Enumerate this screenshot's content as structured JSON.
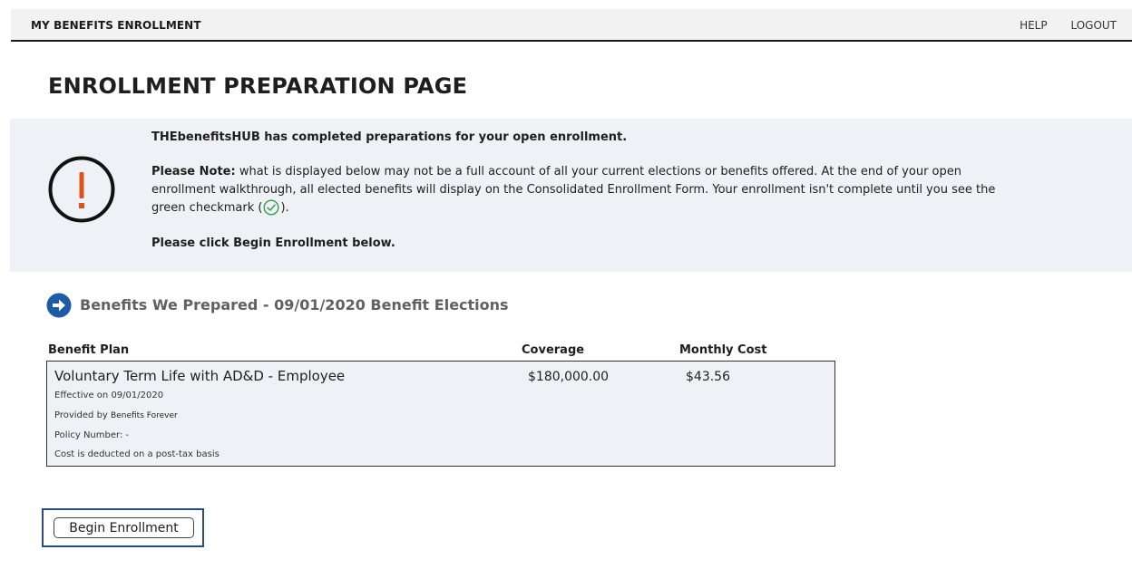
{
  "header": {
    "app_title": "MY BENEFITS ENROLLMENT",
    "nav": {
      "help": "HELP",
      "logout": "LOGOUT"
    }
  },
  "page_title": "ENROLLMENT PREPARATION PAGE",
  "notice": {
    "icon": "warning-exclamation-icon",
    "headline": "THEbenefitsHUB has completed preparations for your open enrollment.",
    "note_label": "Please Note:",
    "note_text": "what is displayed below may not be a full account of all your current elections or benefits offered. At the end of your open enrollment walkthrough, all elected benefits will display on the Consolidated Enrollment Form. Your enrollment isn't complete until you see the green checkmark (",
    "note_suffix": ").",
    "instruction": "Please click Begin Enrollment below."
  },
  "section": {
    "icon": "arrow-right-circle-icon",
    "title": "Benefits We Prepared - 09/01/2020 Benefit Elections"
  },
  "table": {
    "columns": [
      "Benefit Plan",
      "Coverage",
      "Monthly Cost"
    ],
    "rows": [
      {
        "plan": "Voluntary Term Life with AD&D - Employee",
        "coverage": "$180,000.00",
        "monthly_cost": "$43.56",
        "effective": "Effective on 09/01/2020",
        "provided_label": "Provided by",
        "provider": "Benefits Forever",
        "policy": "Policy Number: -",
        "tax_note": "Cost is deducted on a post-tax basis"
      }
    ]
  },
  "actions": {
    "begin_label": "Begin Enrollment"
  },
  "colors": {
    "warning_orange": "#d9531e",
    "check_green": "#3a9a4a",
    "nav_blue": "#1f5aa6",
    "panel_bg": "#eef1f6"
  }
}
